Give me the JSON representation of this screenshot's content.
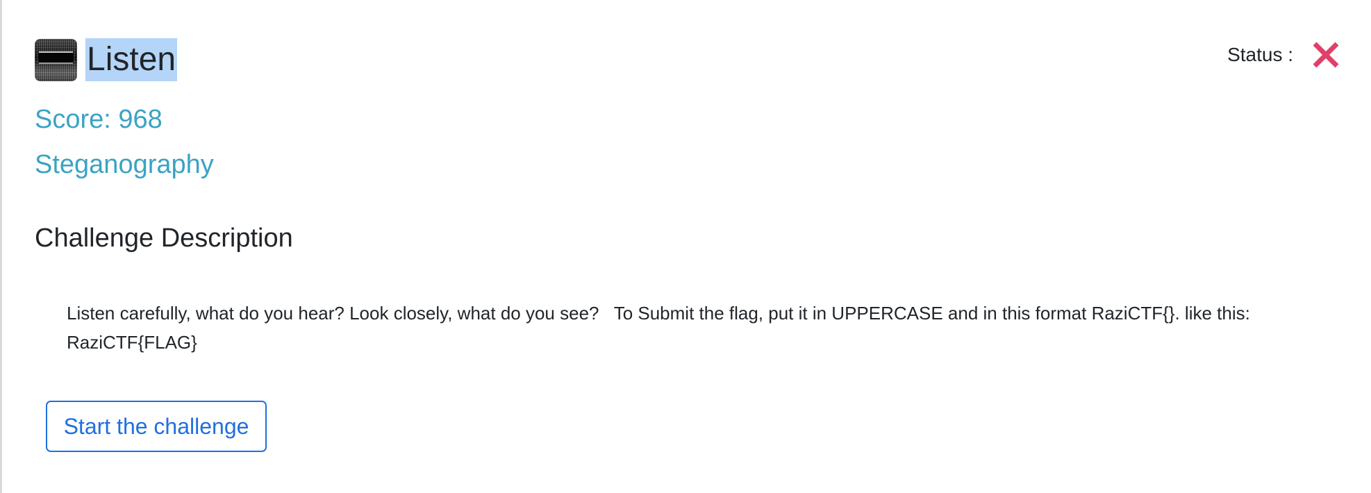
{
  "challenge": {
    "title": "Listen",
    "score_text": "Score: 968",
    "category": "Steganography",
    "thumbnail_icon": "spectrogram-thumbnail-icon"
  },
  "status": {
    "label": "Status :",
    "icon": "close-x-icon",
    "icon_color": "#e0406a"
  },
  "description_section": {
    "heading": "Challenge Description",
    "text": "Listen carefully, what do you hear? Look closely, what do you see?   To Submit the flag, put it in UPPERCASE and in this format RaziCTF{}. like this: RaziCTF{FLAG}"
  },
  "actions": {
    "start_label": "Start the challenge"
  },
  "colors": {
    "accent": "#3aa3c4",
    "button": "#1f6fe0",
    "selection_highlight": "#b4d5f7"
  }
}
